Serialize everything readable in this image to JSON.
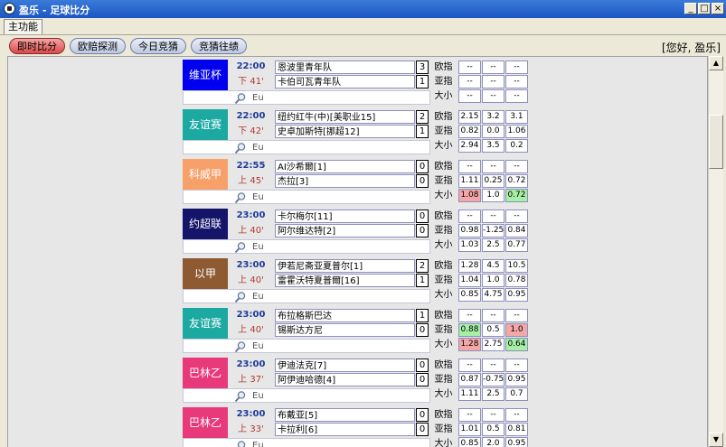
{
  "window": {
    "title": "盈乐 - 足球比分"
  },
  "tabs": [
    "主功能"
  ],
  "toolbar": {
    "buttons": [
      "即时比分",
      "欧赔探测",
      "今日竞猜",
      "竞猜往绩"
    ],
    "greeting": "[您好, 盈乐]"
  },
  "labels": {
    "eu": "Eu",
    "ou": "欧指",
    "asia": "亚指",
    "bs": "大小"
  },
  "colors": {
    "active_button": "#d94a4a",
    "odds_up": "#f4a7a7",
    "odds_down": "#a6f0a6"
  },
  "matches": [
    {
      "league": "维亚杯",
      "league_color": "#0000ee",
      "time": "22:00",
      "period": "下 41'",
      "home": "恩波里青年队",
      "away": "卡伯司瓦青年队",
      "home_score": "3",
      "away_score": "1",
      "odds": [
        [
          "--",
          "--",
          "--"
        ],
        [
          "--",
          "--",
          "--"
        ],
        [
          "--",
          "--",
          "--"
        ]
      ]
    },
    {
      "league": "友谊赛",
      "league_color": "#1ba9a2",
      "time": "22:00",
      "period": "下 42'",
      "home": "纽约红牛(中)[美职业15]",
      "away": "史卓加斯特[挪超12]",
      "home_score": "2",
      "away_score": "1",
      "odds": [
        [
          "2.15",
          "3.2",
          "3.1"
        ],
        [
          "0.82",
          "0.0",
          "1.06"
        ],
        [
          "2.94",
          "3.5",
          "0.2"
        ]
      ]
    },
    {
      "league": "科威甲",
      "league_color": "#f8a06a",
      "time": "22:55",
      "period": "上 45'",
      "home": "AI沙希爾[1]",
      "away": "杰拉[3]",
      "home_score": "0",
      "away_score": "0",
      "odds": [
        [
          "--",
          "--",
          "--"
        ],
        [
          "1.11",
          "0.25",
          "0.72"
        ],
        [
          "1.08",
          "1.0",
          "0.72"
        ]
      ]
    },
    {
      "league": "约超联",
      "league_color": "#14146a",
      "time": "23:00",
      "period": "上 40'",
      "home": "卡尔梅尔[11]",
      "away": "阿尔维达特[2]",
      "home_score": "0",
      "away_score": "0",
      "odds": [
        [
          "--",
          "--",
          "--"
        ],
        [
          "0.98",
          "-1.25",
          "0.84"
        ],
        [
          "1.03",
          "2.5",
          "0.77"
        ]
      ]
    },
    {
      "league": "以甲",
      "league_color": "#8e5a32",
      "time": "23:00",
      "period": "上 40'",
      "home": "伊若尼斋亚夏普尔[1]",
      "away": "雷霍沃特夏普爾[16]",
      "home_score": "2",
      "away_score": "1",
      "odds": [
        [
          "1.28",
          "4.5",
          "10.5"
        ],
        [
          "1.04",
          "1.0",
          "0.78"
        ],
        [
          "0.85",
          "4.75",
          "0.95"
        ]
      ]
    },
    {
      "league": "友谊赛",
      "league_color": "#1ba9a2",
      "time": "23:00",
      "period": "上 40'",
      "home": "布拉格斯巴达",
      "away": "锡斯达方尼",
      "home_score": "1",
      "away_score": "0",
      "odds": [
        [
          "--",
          "--",
          "--"
        ],
        [
          "0.88",
          "0.5",
          "1.0"
        ],
        [
          "1.28",
          "2.75",
          "0.64"
        ]
      ]
    },
    {
      "league": "巴林乙",
      "league_color": "#e8397a",
      "time": "23:00",
      "period": "上 37'",
      "home": "伊迪法克[7]",
      "away": "阿伊迪哈德[4]",
      "home_score": "0",
      "away_score": "0",
      "odds": [
        [
          "--",
          "--",
          "--"
        ],
        [
          "0.87",
          "-0.75",
          "0.95"
        ],
        [
          "1.11",
          "2.5",
          "0.7"
        ]
      ]
    },
    {
      "league": "巴林乙",
      "league_color": "#e8397a",
      "time": "23:00",
      "period": "上 33'",
      "home": "布戴亚[5]",
      "away": "卡拉利[6]",
      "home_score": "0",
      "away_score": "0",
      "odds": [
        [
          "--",
          "--",
          "--"
        ],
        [
          "1.01",
          "0.5",
          "0.81"
        ],
        [
          "0.85",
          "2.0",
          "0.95"
        ]
      ]
    }
  ]
}
